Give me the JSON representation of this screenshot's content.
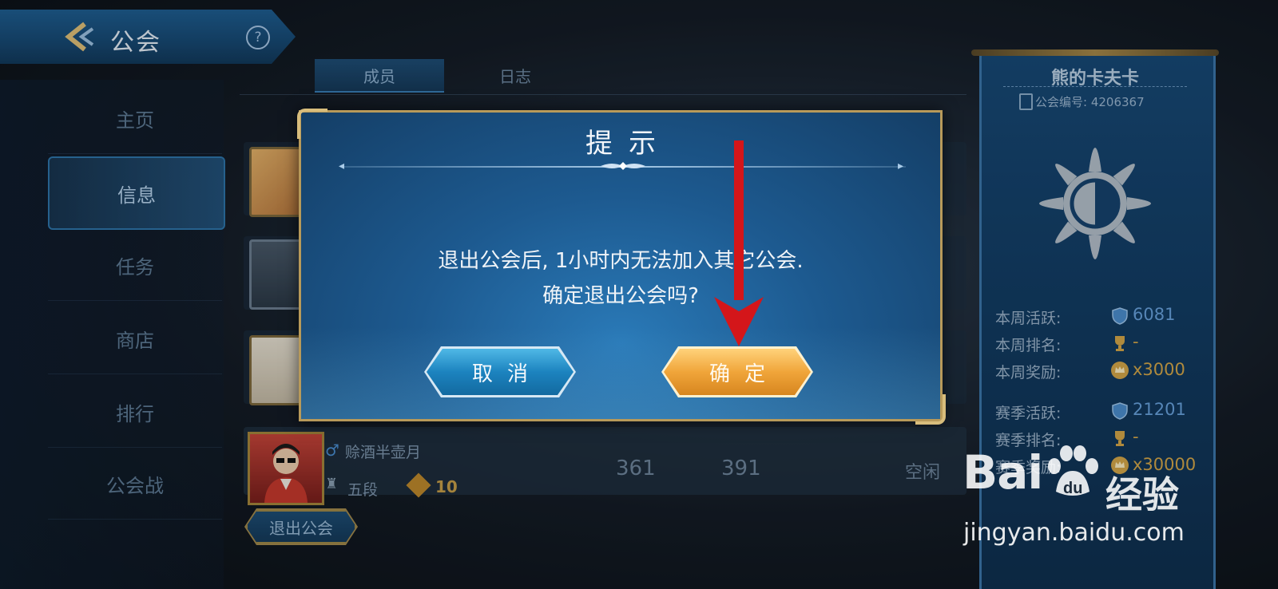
{
  "header": {
    "title": "公会",
    "help": "?"
  },
  "tabs": [
    {
      "label": "成员",
      "active": true
    },
    {
      "label": "日志",
      "active": false
    }
  ],
  "nav": [
    {
      "label": "主页",
      "active": false
    },
    {
      "label": "信息",
      "active": true
    },
    {
      "label": "任务",
      "active": false
    },
    {
      "label": "商店",
      "active": false
    },
    {
      "label": "排行",
      "active": false
    },
    {
      "label": "公会战",
      "active": false
    }
  ],
  "member": {
    "name": "赊酒半壶月",
    "rank": "五段",
    "level": "10",
    "stat1": "361",
    "stat2": "391",
    "status": "空闲"
  },
  "quit_button": "退出公会",
  "guild": {
    "name": "熊的卡夫卡",
    "id_label": "公会编号: 4206367",
    "stats": [
      {
        "label": "本周活跃:",
        "value": "6081",
        "icon": "shield-icon",
        "gold": false
      },
      {
        "label": "本周排名:",
        "value": "-",
        "icon": "trophy-icon",
        "gold": true
      },
      {
        "label": "本周奖励:",
        "value": "x3000",
        "icon": "crown-coin-icon",
        "gold": true
      },
      {
        "label": "赛季活跃:",
        "value": "21201",
        "icon": "shield-icon",
        "gold": false
      },
      {
        "label": "赛季排名:",
        "value": "-",
        "icon": "trophy-icon",
        "gold": true
      },
      {
        "label": "赛季奖励:",
        "value": "x30000",
        "icon": "crown-coin-icon",
        "gold": true
      }
    ]
  },
  "dialog": {
    "title": "提示",
    "message_line1": "退出公会后, 1小时内无法加入其它公会.",
    "message_line2": "确定退出公会吗?",
    "cancel": "取消",
    "confirm": "确定"
  },
  "watermark": {
    "logo": "Bai",
    "logo_cn": "经验",
    "url": "jingyan.baidu.com"
  },
  "colors": {
    "accent_blue": "#1d5a90",
    "confirm_orange": "#f0a53a",
    "arrow_red": "#d4161a"
  }
}
